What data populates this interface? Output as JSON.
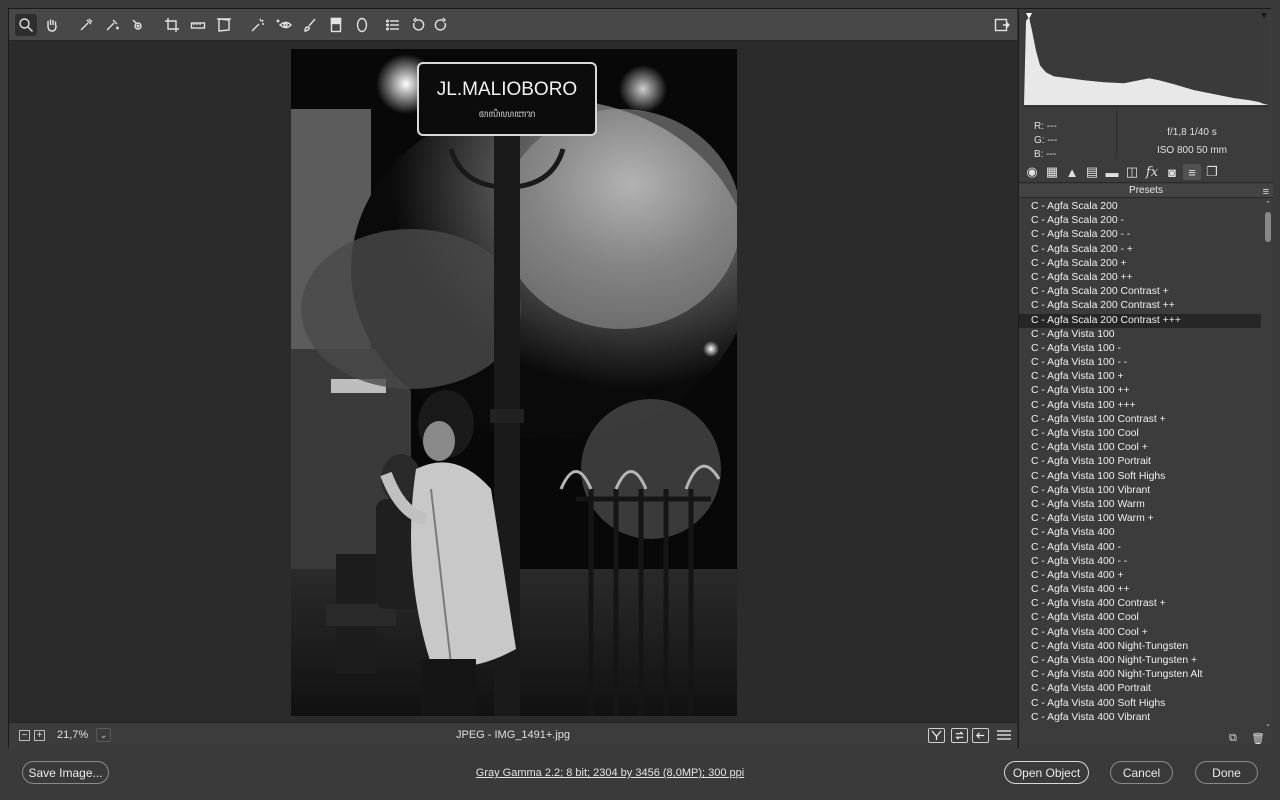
{
  "toolbar": {
    "tools": [
      "zoom-tool",
      "hand-tool",
      "white-balance-tool",
      "color-sampler-tool",
      "targeted-adjustment-tool",
      "crop-tool",
      "straighten-tool",
      "transform-tool",
      "spot-removal-tool",
      "red-eye-tool",
      "adjustment-brush-tool",
      "graduated-filter-tool",
      "radial-filter-tool",
      "presets-list-tool",
      "rotate-left-tool",
      "rotate-right-tool"
    ],
    "fullscreen_icon": "fullscreen-icon"
  },
  "photo": {
    "sign_text": "JL.MALIOBORO",
    "sign_subtext": "ꦩꦭꦶꦪꦧꦫ"
  },
  "status": {
    "zoom_out": "−",
    "zoom_in": "+",
    "zoom": "21,7%",
    "zoom_dropdown": "⌄",
    "filename": "JPEG  -  IMG_1491+.jpg"
  },
  "info": {
    "r": "R:  ---",
    "g": "G:  ---",
    "b": "B:  ---",
    "aperture_shutter": "f/1,8    1/40 s",
    "iso_focal": "ISO 800    50 mm"
  },
  "panel": {
    "title": "Presets",
    "tabs": [
      "basic-tab",
      "tone-curve-tab",
      "detail-tab",
      "hsl-tab",
      "split-toning-tab",
      "lens-corrections-tab",
      "effects-tab",
      "camera-calibration-tab",
      "presets-tab",
      "snapshots-tab"
    ],
    "selected_index": 8,
    "items": [
      "C - Agfa Scala 200",
      "C - Agfa Scala 200 -",
      "C - Agfa Scala 200 - -",
      "C - Agfa Scala 200 - +",
      "C - Agfa Scala 200 +",
      "C - Agfa Scala 200 ++",
      "C - Agfa Scala 200 Contrast +",
      "C - Agfa Scala 200 Contrast ++",
      "C - Agfa Scala 200 Contrast +++",
      "C - Agfa Vista 100",
      "C - Agfa Vista 100 -",
      "C - Agfa Vista 100 - -",
      "C - Agfa Vista 100 +",
      "C - Agfa Vista 100 ++",
      "C - Agfa Vista 100 +++",
      "C - Agfa Vista 100 Contrast +",
      "C - Agfa Vista 100 Cool",
      "C - Agfa Vista 100 Cool +",
      "C - Agfa Vista 100 Portrait",
      "C - Agfa Vista 100 Soft Highs",
      "C - Agfa Vista 100 Vibrant",
      "C - Agfa Vista 100 Warm",
      "C - Agfa Vista 100 Warm +",
      "C - Agfa Vista 400",
      "C - Agfa Vista 400 -",
      "C - Agfa Vista 400 - -",
      "C - Agfa Vista 400 +",
      "C - Agfa Vista 400 ++",
      "C - Agfa Vista 400 Contrast +",
      "C - Agfa Vista 400 Cool",
      "C - Agfa Vista 400 Cool +",
      "C - Agfa Vista 400 Night-Tungsten",
      "C - Agfa Vista 400 Night-Tungsten +",
      "C - Agfa Vista 400 Night-Tungsten Alt",
      "C - Agfa Vista 400 Portrait",
      "C - Agfa Vista 400 Soft Highs",
      "C - Agfa Vista 400 Vibrant"
    ]
  },
  "bottom": {
    "save": "Save Image...",
    "doc_info": "Gray Gamma 2.2; 8 bit; 2304 by 3456 (8,0MP); 300 ppi",
    "open": "Open Object",
    "cancel": "Cancel",
    "done": "Done"
  },
  "colors": {
    "background": "#3a3a3a",
    "panel": "#3c3c3c",
    "canvas": "#2b2b2b",
    "selected_row": "#262626"
  }
}
